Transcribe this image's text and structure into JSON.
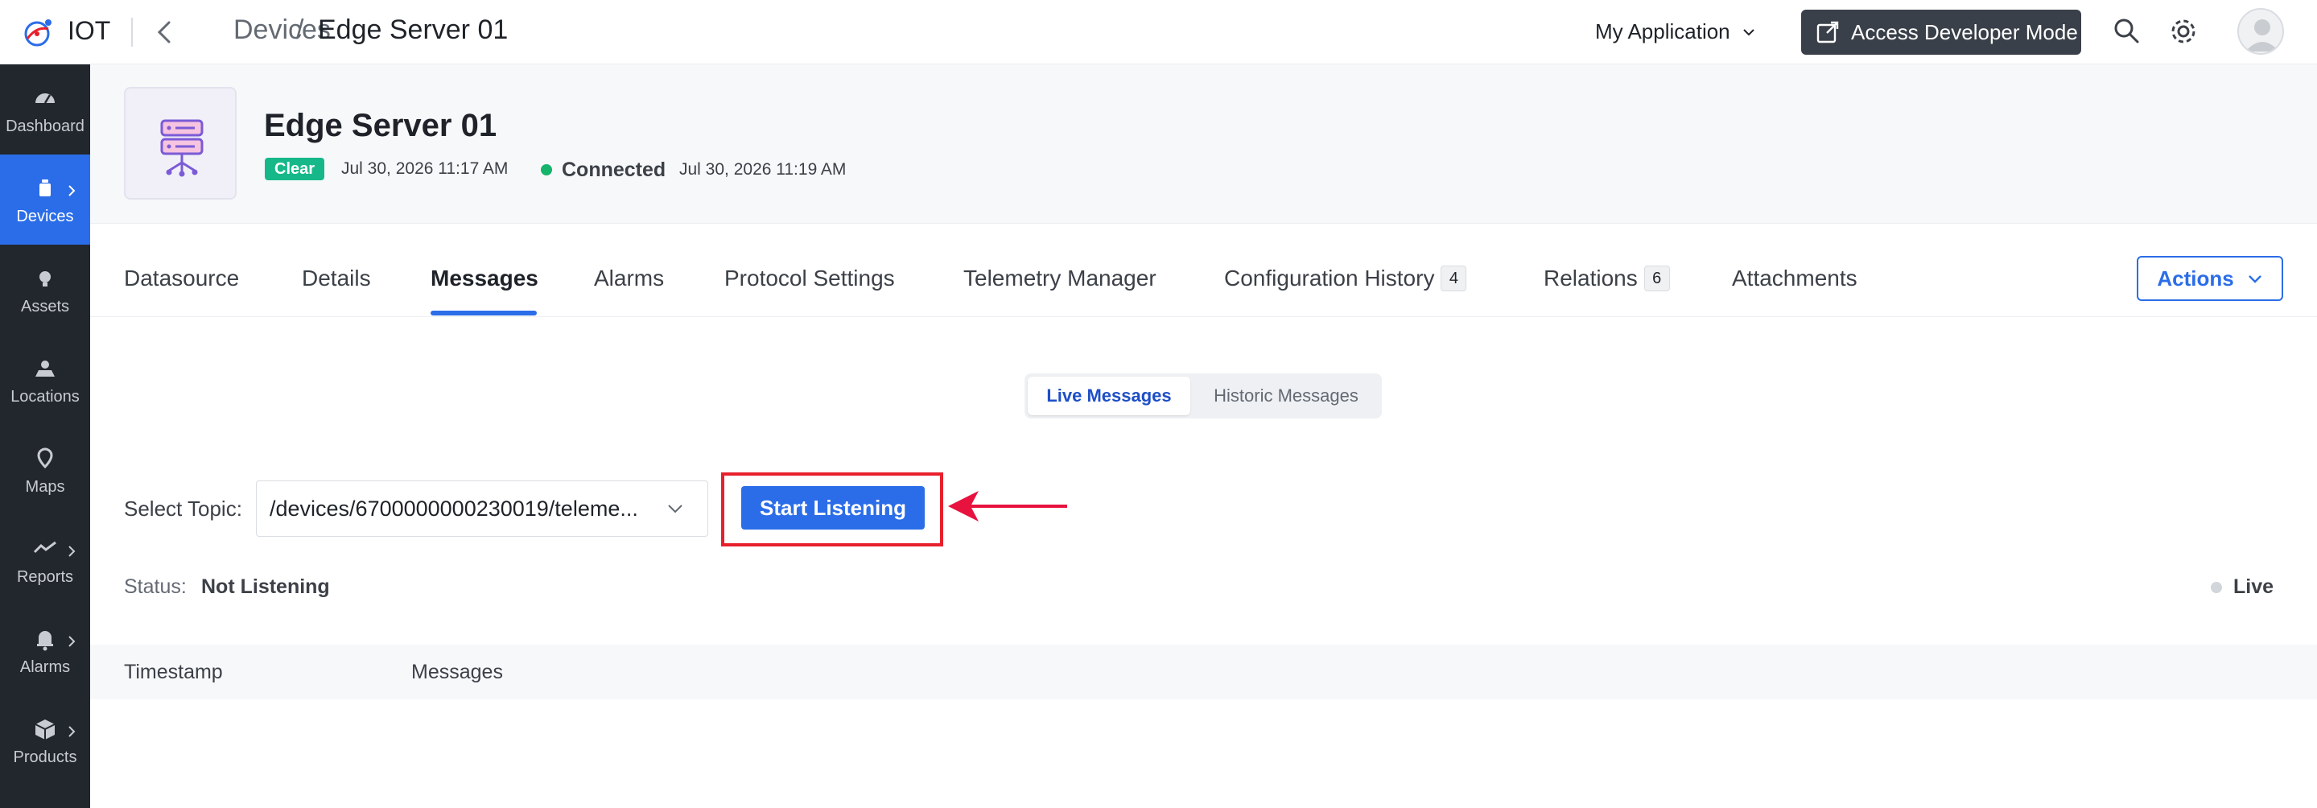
{
  "app": {
    "name": "IOT"
  },
  "breadcrumb": {
    "parent": "Devices",
    "separator": "/",
    "current": "Edge Server 01"
  },
  "header": {
    "app_selector": "My Application",
    "dev_mode_button": "Access Developer Mode"
  },
  "sidebar": {
    "items": [
      {
        "label": "Dashboard",
        "icon": "dashboard-icon",
        "active": false,
        "has_chevron": false
      },
      {
        "label": "Devices",
        "icon": "device-icon",
        "active": true,
        "has_chevron": true
      },
      {
        "label": "Assets",
        "icon": "asset-icon",
        "active": false,
        "has_chevron": false
      },
      {
        "label": "Locations",
        "icon": "location-icon",
        "active": false,
        "has_chevron": false
      },
      {
        "label": "Maps",
        "icon": "map-pin-icon",
        "active": false,
        "has_chevron": false
      },
      {
        "label": "Reports",
        "icon": "report-icon",
        "active": false,
        "has_chevron": true
      },
      {
        "label": "Alarms",
        "icon": "bell-icon",
        "active": false,
        "has_chevron": true
      },
      {
        "label": "Products",
        "icon": "box-icon",
        "active": false,
        "has_chevron": true
      }
    ]
  },
  "device": {
    "title": "Edge Server 01",
    "alarm_status": "Clear",
    "alarm_time": "Jul 30, 2026 11:17 AM",
    "connection_status": "Connected",
    "connection_time": "Jul 30, 2026 11:19 AM"
  },
  "tabs": {
    "datasource": "Datasource",
    "details": "Details",
    "messages": "Messages",
    "alarms": "Alarms",
    "protocol_settings": "Protocol Settings",
    "telemetry_manager": "Telemetry Manager",
    "configuration_history": "Configuration History",
    "configuration_history_count": "4",
    "relations": "Relations",
    "relations_count": "6",
    "attachments": "Attachments",
    "active": "Messages"
  },
  "actions_button": "Actions",
  "message_mode": {
    "live": "Live Messages",
    "historic": "Historic Messages",
    "selected": "Live Messages"
  },
  "topic": {
    "label": "Select Topic:",
    "value": "/devices/6700000000230019/teleme...",
    "start_button": "Start Listening"
  },
  "status": {
    "label": "Status:",
    "value": "Not Listening",
    "live_label": "Live"
  },
  "table": {
    "columns": [
      "Timestamp",
      "Messages"
    ]
  },
  "colors": {
    "accent": "#2b6de8",
    "sidebar_bg": "#22262d",
    "clear_badge": "#16b889",
    "connected_dot": "#16b36b",
    "highlight": "#e8202c"
  }
}
